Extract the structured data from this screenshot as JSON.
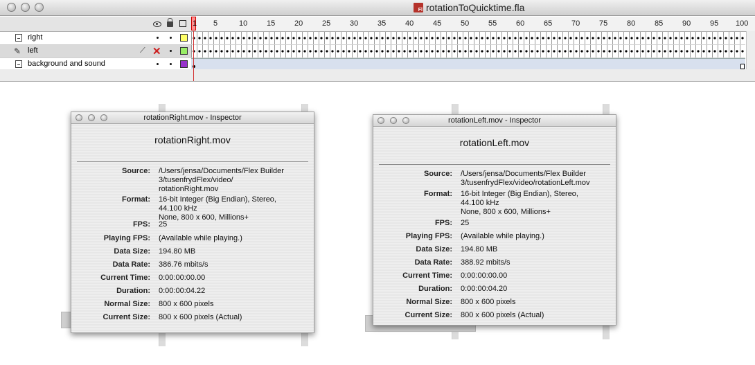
{
  "flash": {
    "title": "rotationToQuicktime.fla",
    "file_icon_label": "Fl",
    "ruler_ticks": [
      "1",
      "5",
      "10",
      "15",
      "20",
      "25",
      "30",
      "35",
      "40",
      "45",
      "50",
      "55",
      "60",
      "65",
      "70",
      "75",
      "80",
      "85",
      "90",
      "95",
      "100"
    ],
    "current_frame": "1",
    "layers": [
      {
        "name": "right",
        "color": "#ffff66"
      },
      {
        "name": "left",
        "color": "#99ee66"
      },
      {
        "name": "background and sound",
        "color": "#9933cc"
      }
    ]
  },
  "inspectors": [
    {
      "title": "rotationRight.mov - Inspector",
      "filename": "rotationRight.mov",
      "labels": [
        "Source:",
        "Format:",
        "FPS:",
        "Playing FPS:",
        "Data Size:",
        "Data Rate:",
        "Current Time:",
        "Duration:",
        "Normal Size:",
        "Current Size:"
      ],
      "values": [
        "/Users/jensa/Documents/Flex Builder\n3/tusenfrydFlex/video/\nrotationRight.mov",
        "16-bit Integer (Big Endian), Stereo,\n44.100 kHz\nNone, 800 x 600, Millions+",
        "25",
        "(Available while playing.)",
        "194.80 MB",
        "386.76 mbits/s",
        "0:00:00:00.00",
        "0:00:00:04.22",
        "800 x 600 pixels",
        "800 x 600 pixels (Actual)"
      ]
    },
    {
      "title": "rotationLeft.mov - Inspector",
      "filename": "rotationLeft.mov",
      "labels": [
        "Source:",
        "Format:",
        "FPS:",
        "Playing FPS:",
        "Data Size:",
        "Data Rate:",
        "Current Time:",
        "Duration:",
        "Normal Size:",
        "Current Size:"
      ],
      "values": [
        "/Users/jensa/Documents/Flex Builder\n3/tusenfrydFlex/video/rotationLeft.mov",
        "16-bit Integer (Big Endian), Stereo,\n44.100 kHz\nNone, 800 x 600, Millions+",
        "25",
        "(Available while playing.)",
        "194.80 MB",
        "388.92 mbits/s",
        "0:00:00:00.00",
        "0:00:00:04.20",
        "800 x 600 pixels",
        "800 x 600 pixels (Actual)"
      ]
    }
  ]
}
